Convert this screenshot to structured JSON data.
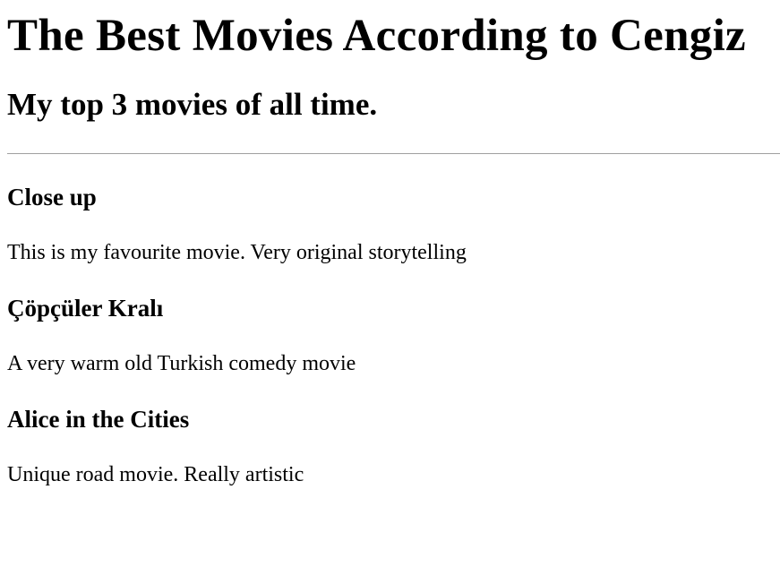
{
  "page": {
    "title": "The Best Movies According to Cengiz",
    "subtitle": "My top 3 movies of all time."
  },
  "movies": [
    {
      "title": "Close up",
      "description": "This is my favourite movie. Very original storytelling"
    },
    {
      "title": "Çöpçüler Kralı",
      "description": "A very warm old Turkish comedy movie"
    },
    {
      "title": "Alice in the Cities",
      "description": "Unique road movie. Really artistic"
    }
  ]
}
